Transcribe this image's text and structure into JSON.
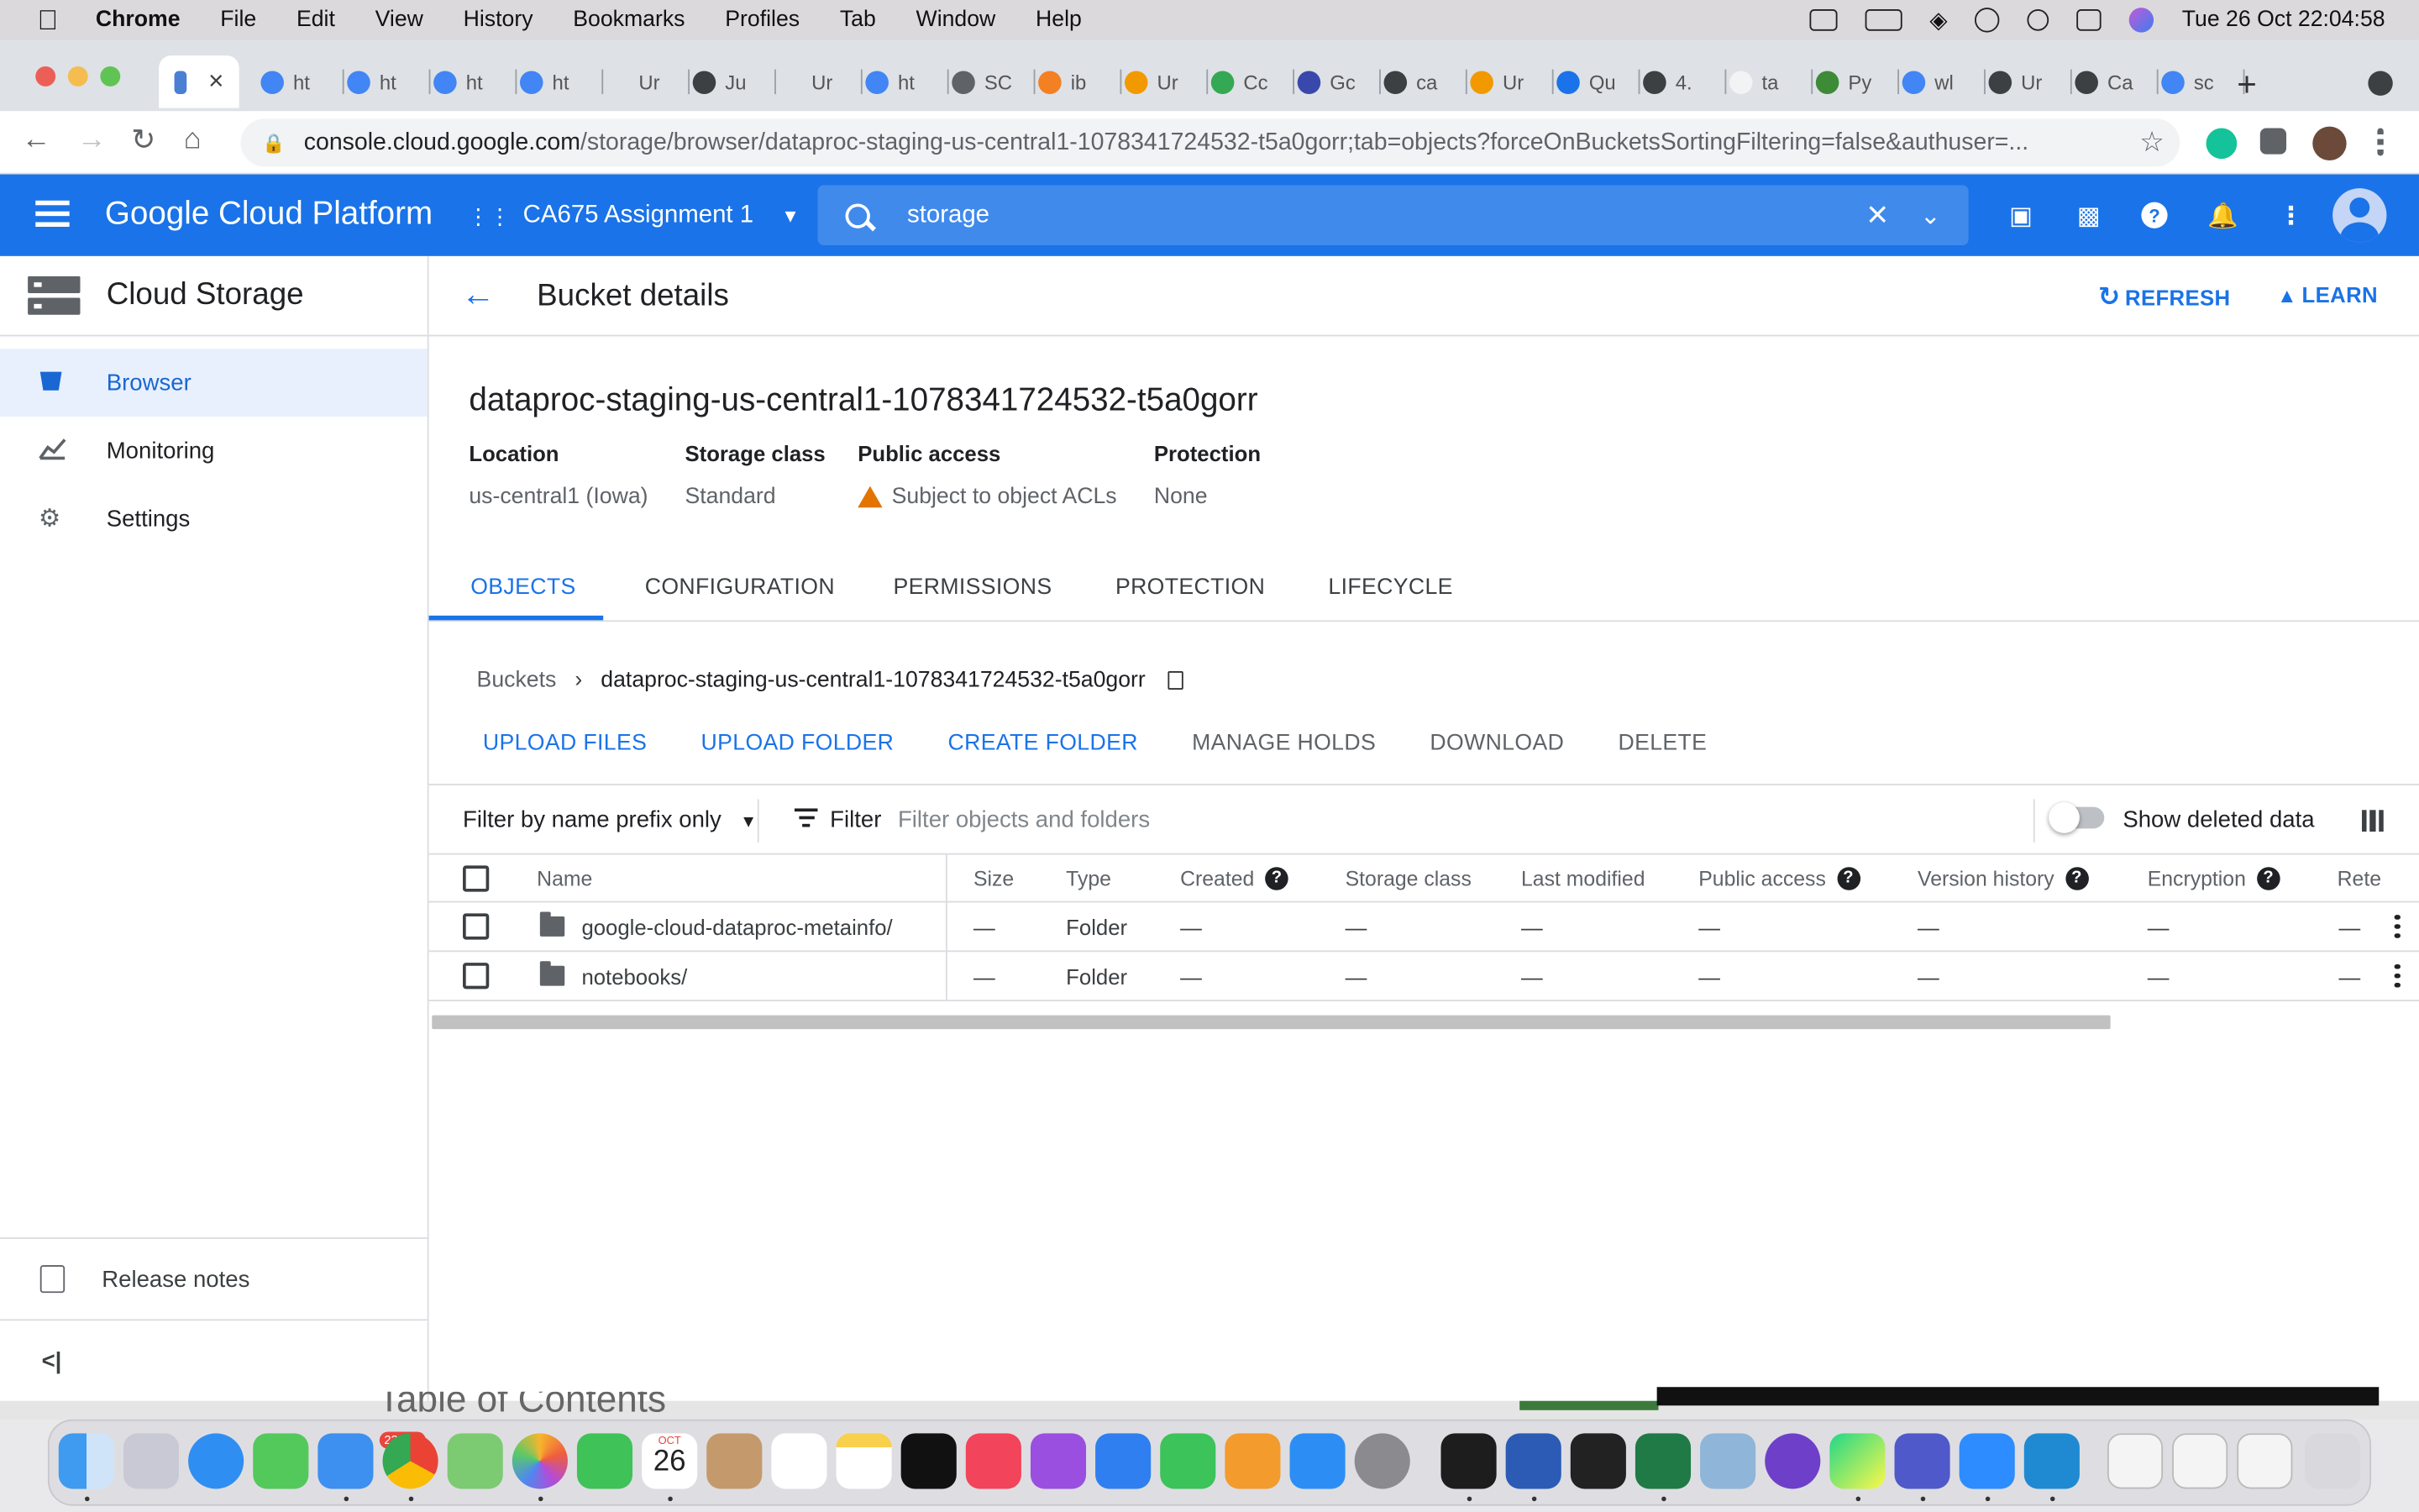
{
  "menubar": {
    "app": "Chrome",
    "items": [
      "File",
      "Edit",
      "View",
      "History",
      "Bookmarks",
      "Profiles",
      "Tab",
      "Window",
      "Help"
    ],
    "clock": "Tue 26 Oct  22:04:58"
  },
  "tabs": [
    {
      "label": "",
      "icon": "gcp-icon",
      "active": true
    },
    {
      "label": "ht",
      "icon": "google-icon"
    },
    {
      "label": "ht",
      "icon": "google-icon"
    },
    {
      "label": "ht",
      "icon": "google-icon"
    },
    {
      "label": "ht",
      "icon": "google-icon"
    },
    {
      "label": "Ur",
      "icon": "blank-icon"
    },
    {
      "label": "Ju",
      "icon": "globe-icon"
    },
    {
      "label": "Ur",
      "icon": "blank-icon"
    },
    {
      "label": "ht",
      "icon": "google-icon"
    },
    {
      "label": "SC",
      "icon": "gear-icon"
    },
    {
      "label": "ib",
      "icon": "stack-icon"
    },
    {
      "label": "Ur",
      "icon": "link-icon"
    },
    {
      "label": "Cc",
      "icon": "drive-icon"
    },
    {
      "label": "Gc",
      "icon": "grid-icon"
    },
    {
      "label": "ca",
      "icon": "globe-icon"
    },
    {
      "label": "Ur",
      "icon": "link-icon"
    },
    {
      "label": "Qu",
      "icon": "list-icon"
    },
    {
      "label": "4.",
      "icon": "globe-icon"
    },
    {
      "label": "ta",
      "icon": "page-icon"
    },
    {
      "label": "Py",
      "icon": "python-icon"
    },
    {
      "label": "wl",
      "icon": "google-icon"
    },
    {
      "label": "Ur",
      "icon": "globe-icon"
    },
    {
      "label": "Ca",
      "icon": "globe-icon"
    },
    {
      "label": "sc",
      "icon": "google-icon"
    }
  ],
  "browser": {
    "url_host": "console.cloud.google.com",
    "url_path": "/storage/browser/dataproc-staging-us-central1-1078341724532-t5a0gorr;tab=objects?forceOnBucketsSortingFiltering=false&authuser=..."
  },
  "gcp": {
    "title": "Google Cloud Platform",
    "project": "CA675 Assignment 1",
    "search_value": "storage"
  },
  "sidebar": {
    "title": "Cloud Storage",
    "items": [
      {
        "label": "Browser",
        "icon": "bucket-icon",
        "active": true
      },
      {
        "label": "Monitoring",
        "icon": "chart-icon"
      },
      {
        "label": "Settings",
        "icon": "gear-icon"
      }
    ],
    "release_notes": "Release notes",
    "collapse": "<|"
  },
  "page": {
    "title": "Bucket details",
    "refresh": "REFRESH",
    "learn": "LEARN",
    "bucket_name": "dataproc-staging-us-central1-1078341724532-t5a0gorr",
    "meta": [
      {
        "label": "Location",
        "value": "us-central1 (Iowa)"
      },
      {
        "label": "Storage class",
        "value": "Standard"
      },
      {
        "label": "Public access",
        "value": "Subject to object ACLs",
        "warning": true
      },
      {
        "label": "Protection",
        "value": "None"
      }
    ],
    "tabs": [
      "OBJECTS",
      "CONFIGURATION",
      "PERMISSIONS",
      "PROTECTION",
      "LIFECYCLE"
    ],
    "active_tab": "OBJECTS",
    "breadcrumb_root": "Buckets",
    "breadcrumb_current": "dataproc-staging-us-central1-1078341724532-t5a0gorr",
    "actions": [
      "UPLOAD FILES",
      "UPLOAD FOLDER",
      "CREATE FOLDER",
      "MANAGE HOLDS",
      "DOWNLOAD",
      "DELETE"
    ],
    "filter_mode": "Filter by name prefix only",
    "filter_label": "Filter",
    "filter_placeholder": "Filter objects and folders",
    "show_deleted": "Show deleted data",
    "columns": [
      "Name",
      "Size",
      "Type",
      "Created",
      "Storage class",
      "Last modified",
      "Public access",
      "Version history",
      "Encryption",
      "Rete"
    ],
    "rows": [
      {
        "name": "google-cloud-dataproc-metainfo/",
        "size": "—",
        "type": "Folder",
        "created": "—",
        "storage_class": "—",
        "last_modified": "—",
        "public_access": "—",
        "version_history": "—",
        "encryption": "—",
        "retention": "—"
      },
      {
        "name": "notebooks/",
        "size": "—",
        "type": "Folder",
        "created": "—",
        "storage_class": "—",
        "last_modified": "—",
        "public_access": "—",
        "version_history": "—",
        "encryption": "—",
        "retention": "—"
      }
    ]
  },
  "bg_window_text": "Table of Contents",
  "dock": {
    "calendar_month": "OCT",
    "calendar_day": "26",
    "mail_badge": "23,675"
  }
}
